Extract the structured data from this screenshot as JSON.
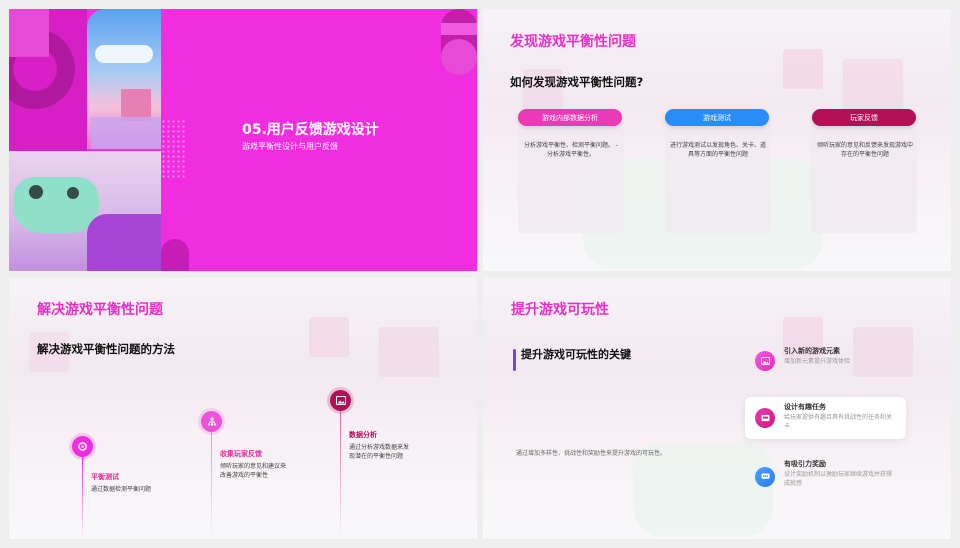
{
  "colors": {
    "magenta": "#f02ee0",
    "pink": "#ea3ab5",
    "blue": "#2a8cf6",
    "crimson": "#b3105a",
    "title": "#e730c8"
  },
  "slide1": {
    "title": "05.用户反馈游戏设计",
    "subtitle": "游戏平衡性设计与用户反馈"
  },
  "slide2": {
    "title": "发现游戏平衡性问题",
    "heading": "如何发现游戏平衡性问题?",
    "cols": [
      {
        "label": "游戏内部数据分析",
        "desc": "分析游戏平衡性、检测平衡问题。 - 分析游戏平衡性。",
        "color": "#ea3ab5"
      },
      {
        "label": "游戏测试",
        "desc": "进行游戏测试以发现角色、关卡、道具等方面的平衡性问题",
        "color": "#2a8cf6"
      },
      {
        "label": "玩家反馈",
        "desc": "倾听玩家的意见和反馈来发现游戏中存在的平衡性问题",
        "color": "#b3105a"
      }
    ]
  },
  "slide3": {
    "title": "解决游戏平衡性问题",
    "heading": "解决游戏平衡性问题的方法",
    "steps": [
      {
        "title": "平衡测试",
        "desc": "通过数据检测平衡问题",
        "icon": "target-icon",
        "color": "#f02ee0"
      },
      {
        "title": "收集玩家反馈",
        "desc": "倾听玩家的意见和建议来改善游戏的平衡性",
        "icon": "team-icon",
        "color": "#e83cc8"
      },
      {
        "title": "数据分析",
        "desc": "通过分析游戏数据来发现潜在的平衡性问题",
        "icon": "image-icon",
        "color": "#b3105a"
      }
    ]
  },
  "slide4": {
    "title": "提升游戏可玩性",
    "heading": "提升游戏可玩性的关键",
    "summary": "通过增加多样性、挑战性和奖励性来提升游戏的可玩性。",
    "items": [
      {
        "title": "引入新的游戏元素",
        "desc": "增加新元素提升游戏体验",
        "icon": "picture-icon",
        "color": "#f02ee0"
      },
      {
        "title": "设计有趣任务",
        "desc": "给玩家提供有趣且具有挑战性的任务和关卡",
        "icon": "inbox-icon",
        "color": "#e02e9a"
      },
      {
        "title": "有吸引力奖励",
        "desc": "设计奖励机制以激励玩家继续游戏并获得成就感",
        "icon": "chat-icon",
        "color": "#2a8cf6"
      }
    ]
  }
}
